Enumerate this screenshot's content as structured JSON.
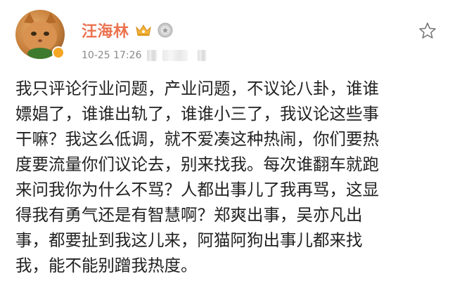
{
  "post": {
    "author": "汪海林",
    "time": "10-25 17:26",
    "content": "我只评论行业问题，产业问题，不议论八卦，谁谁\n嫖娼了，谁谁出轨了，谁谁小三了，我议论这些事\n干嘛？我这么低调，就不爱凑这种热闹，你们要热\n度要流量你们议论去，别来找我。每次谁翻车就跑\n来问我你为什么不骂？人都出事儿了我再骂，这显\n得我有勇气还是有智慧啊？郑爽出事，吴亦凡出\n事，都要扯到我这儿来，阿猫阿狗出事儿都来找\n我，能不能别蹭我热度。"
  },
  "icons": {
    "avatar": "cat-avatar",
    "verified": "verified-badge-icon",
    "crown": "crown-icon",
    "medal": "medal-icon",
    "favorite": "star-icon"
  },
  "colors": {
    "author_name": "#eb7350",
    "time_text": "#888888",
    "body_text": "#222222",
    "verified_badge": "#f5a623"
  }
}
